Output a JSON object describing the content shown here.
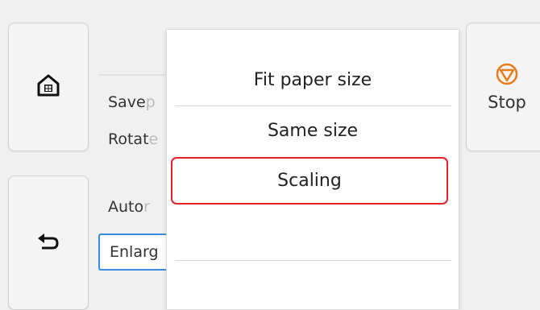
{
  "nav": {
    "home_icon": "home-icon",
    "back_icon": "back-arrow-icon",
    "stop_icon": "stop-icon",
    "stop_label": "Stop",
    "accent_stop": "#e57c1a"
  },
  "background_menu": {
    "items": [
      {
        "visible": "Save ",
        "faded": "p"
      },
      {
        "visible": "Rotat",
        "faded": "e"
      },
      {
        "visible": "Auto ",
        "faded": "r"
      },
      {
        "visible": "Enlarg",
        "faded": ""
      }
    ]
  },
  "dropdown": {
    "options": [
      "Fit paper size",
      "Same size",
      "Scaling"
    ],
    "highlighted": "Scaling",
    "highlight_color": "#e5222a"
  }
}
